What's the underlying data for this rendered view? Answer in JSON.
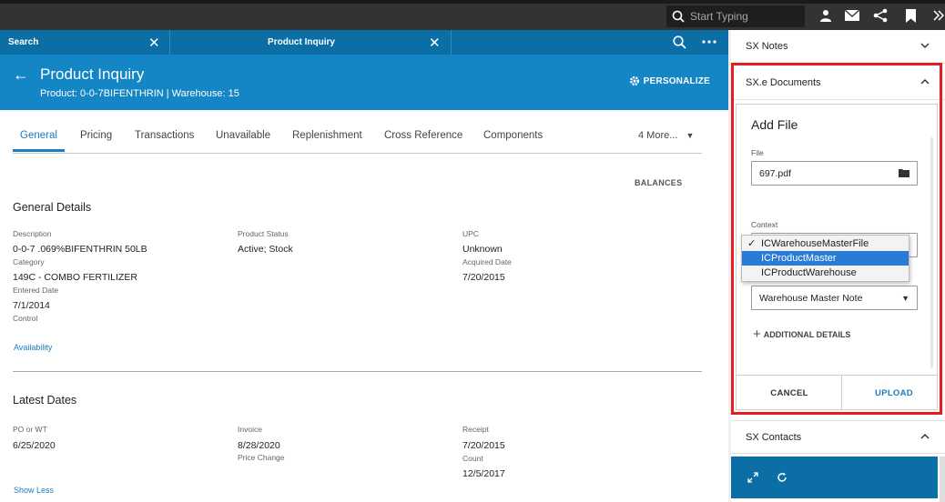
{
  "topbar": {
    "search_placeholder": "Start Typing",
    "icons": [
      "search-icon",
      "user-icon",
      "mail-icon",
      "share-icon",
      "bookmark-icon",
      "expand-icon"
    ]
  },
  "tabs": [
    {
      "label": "Search"
    },
    {
      "label": "Product Inquiry"
    }
  ],
  "header": {
    "title": "Product Inquiry",
    "subtitle": "Product: 0-0-7BIFENTHRIN | Warehouse: 15",
    "personalize": "PERSONALIZE"
  },
  "navtabs": [
    "General",
    "Pricing",
    "Transactions",
    "Unavailable",
    "Replenishment",
    "Cross Reference",
    "Components"
  ],
  "more_tabs": "4 More...",
  "balances": "BALANCES",
  "general": {
    "title": "General Details",
    "description_label": "Description",
    "description_value": "0-0-7 .069%BIFENTHRIN 50LB",
    "category_label": "Category",
    "category_value": "149C - COMBO FERTILIZER",
    "entered_label": "Entered Date",
    "entered_value": "7/1/2014",
    "control_label": "Control",
    "status_label": "Product Status",
    "status_value": "Active; Stock",
    "upc_label": "UPC",
    "upc_value": "Unknown",
    "acquired_label": "Acquired Date",
    "acquired_value": "7/20/2015",
    "availability_link": "Availability"
  },
  "latest": {
    "title": "Latest Dates",
    "po_label": "PO or WT",
    "po_value": "6/25/2020",
    "invoice_label": "Invoice",
    "invoice_value": "8/28/2020",
    "price_change_label": "Price Change",
    "receipt_label": "Receipt",
    "receipt_value": "7/20/2015",
    "count_label": "Count",
    "count_value": "12/5/2017",
    "show_less": "Show Less"
  },
  "right": {
    "sx_notes": "SX Notes",
    "sxe_documents": "SX.e Documents",
    "sx_contacts": "SX Contacts",
    "add_file": {
      "title": "Add File",
      "file_label": "File",
      "file_value": "697.pdf",
      "context_label": "Context",
      "context_options": [
        "ICWarehouseMasterFile",
        "ICProductMaster",
        "ICProductWarehouse"
      ],
      "checked_option": "✓",
      "note_type_value": "Warehouse Master Note",
      "additional_details": "ADDITIONAL DETAILS",
      "cancel": "CANCEL",
      "upload": "UPLOAD"
    }
  },
  "colors": {
    "brand_blue": "#1486c6",
    "tab_blue": "#0b6ea5",
    "highlight_red": "#e41e1e",
    "link_blue": "#1a7ec0",
    "selection_blue": "#2a7bd5"
  }
}
